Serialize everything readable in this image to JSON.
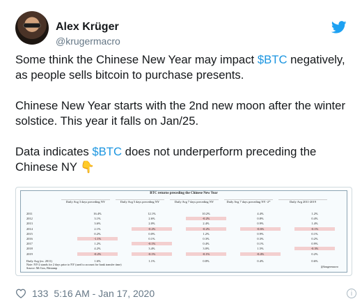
{
  "author": {
    "name": "Alex Krüger",
    "handle": "@krugermacro"
  },
  "tweet": {
    "p1_before": "Some think the Chinese New Year may impact ",
    "p1_cashtag": "$BTC",
    "p1_after": " negatively, as people sells bitcoin to purchase presents.",
    "p2": "Chinese New Year starts with the 2nd new moon after the winter solstice. This year it falls on Jan/25.",
    "p3_before": "Data indicates ",
    "p3_cashtag": "$BTC",
    "p3_after": " does not underperform preceding the Chinese NY ",
    "emoji": "👇"
  },
  "table": {
    "title": "BTC returns preceding the Chinese New Year",
    "headers": [
      "Daily Avg 3 days preceding NY",
      "Daily Avg 5 days preceding NY",
      "Daily Avg 7 days preceding NY",
      "Daily Avg 7 days preceding NY -2*",
      "Daily Avg 2011-2019"
    ],
    "rows": [
      [
        "2011",
        "16.4%",
        "12.1%",
        "10.2%",
        "4.4%",
        "1.2%"
      ],
      [
        "2012",
        "3.1%",
        "2.6%",
        "-0.2%",
        "0.8%",
        "0.4%"
      ],
      [
        "2013",
        "3.6%",
        "2.0%",
        "2.4%",
        "0.9%",
        "1.4%"
      ],
      [
        "2014",
        "2.1%",
        "-0.2%",
        "-0.2%",
        "-0.6%",
        "-0.1%"
      ],
      [
        "2015",
        "0.2%",
        "0.0%",
        "1.2%",
        "0.9%",
        "0.1%"
      ],
      [
        "2016",
        "-1.1%",
        "0.1%",
        "0.3%",
        "0.3%",
        "0.2%"
      ],
      [
        "2017",
        "1.2%",
        "-0.1%",
        "0.4%",
        "0.1%",
        "0.9%"
      ],
      [
        "2018",
        "4.2%",
        "3.4%",
        "3.0%",
        "1.5%",
        "-0.3%"
      ],
      [
        "2019",
        "-0.2%",
        "-0.1%",
        "-0.1%",
        "-0.4%",
        "0.2%"
      ]
    ],
    "avg_row": [
      "Daily Avg (ex. 2011)",
      "1.6%",
      "1.1%",
      "0.8%",
      "0.4%",
      "0.6%"
    ],
    "note1": "Note: NY-2 stands for 2 days prior to NY (used to account for bank transfer time)",
    "note2": "Source: Mt Gox, Bitstamp",
    "watermark": "@krugermacro"
  },
  "meta": {
    "likes": "133",
    "timestamp": "5:16 AM - Jan 17, 2020",
    "info": "i"
  },
  "colors": {
    "accent": "#1b95e0",
    "negative_cell": "#f3cfcf"
  }
}
